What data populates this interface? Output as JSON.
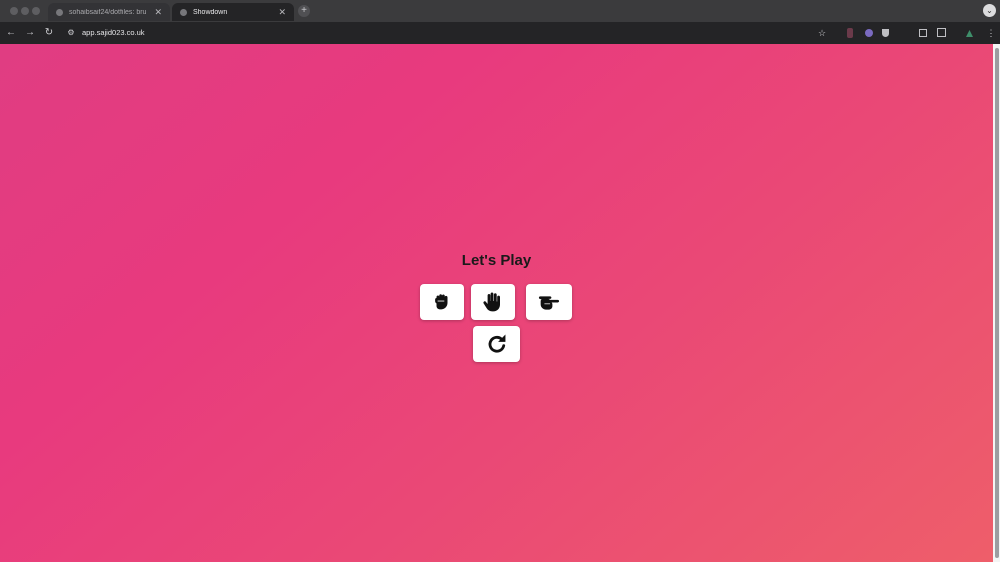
{
  "browser": {
    "tabs": [
      {
        "label": "sohaibsaif24/dotfiles: bru",
        "active": false
      },
      {
        "label": "Showdown",
        "active": true
      }
    ],
    "url": "app.sajid023.co.uk"
  },
  "game": {
    "title": "Let's Play",
    "choices": [
      {
        "name": "rock",
        "icon": "fist-icon"
      },
      {
        "name": "paper",
        "icon": "open-hand-icon"
      },
      {
        "name": "scissors",
        "icon": "scissors-hand-icon"
      }
    ],
    "reset_icon": "redo-icon"
  },
  "colors": {
    "background_start": "#e03d82",
    "background_end": "#ee5e6a",
    "button_bg": "#ffffff",
    "icon": "#111111"
  }
}
